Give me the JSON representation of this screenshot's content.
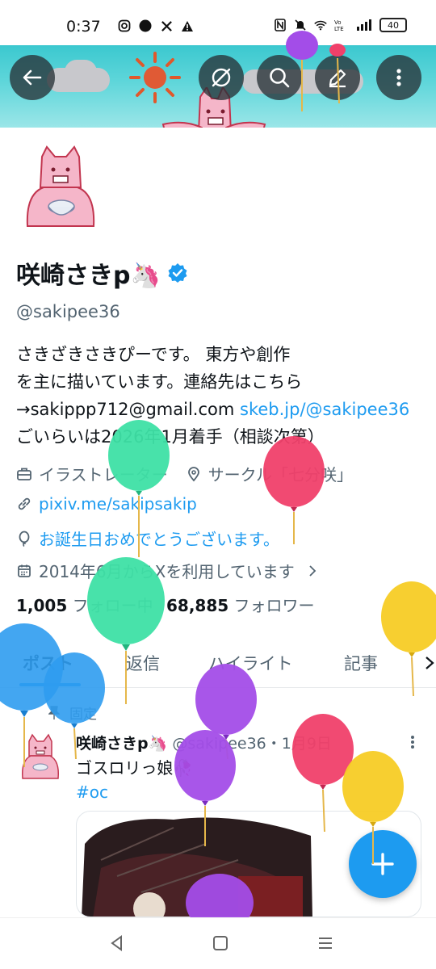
{
  "status_bar": {
    "time": "0:37",
    "battery": "40",
    "left_icons": [
      "instagram-icon",
      "zozotown-icon",
      "x-icon",
      "warning-icon"
    ],
    "right_icons": [
      "nfc-icon",
      "mute-icon",
      "wifi-icon",
      "volte-icon",
      "signal-icon",
      "battery-icon"
    ]
  },
  "header": {
    "buttons": [
      "back-icon",
      "hide-icon",
      "search-icon",
      "edit-icon",
      "more-icon"
    ]
  },
  "profile": {
    "name": "咲崎さきp🦄",
    "handle": "@sakipee36",
    "bio_line1": "さきざきさきぴーです。 東方や創作",
    "bio_line2": "を主に描いています。連絡先はこちら",
    "bio_line3_prefix": "→sakippp712@gmail.com ",
    "bio_line3_link": "skeb.jp/@sakipee36",
    "bio_line4": "ごいらいは2026年1月着手（相談次第）",
    "job": "イラストレーター",
    "location": "サークル「七分咲」",
    "website": "pixiv.me/sakipsakip",
    "birthday": "お誕生日おめでとうございます。",
    "joined": "2014年6月からXを利用しています",
    "following_count": "1,005",
    "following_label": "フォロー中",
    "followers_count": "68,885",
    "followers_label": "フォロワー"
  },
  "tabs": [
    {
      "label": "ポスト",
      "active": true
    },
    {
      "label": "返信",
      "active": false
    },
    {
      "label": "ハイライト",
      "active": false
    },
    {
      "label": "記事",
      "active": false
    }
  ],
  "post": {
    "pinned_label": "固定",
    "author": "咲崎さきp🦄",
    "handle_time": "@sakipee36・1月9日",
    "text": "ゴスロリっ娘🥀",
    "hashtag": "#oc"
  },
  "colors": {
    "accent": "#1d9bf0",
    "banner": "#3bc8cf",
    "balloon_green": "#3ee0a5",
    "balloon_pink": "#f0406a",
    "balloon_purple": "#a34de8",
    "balloon_yellow": "#f7cc25",
    "balloon_blue": "#2f9cf0"
  }
}
